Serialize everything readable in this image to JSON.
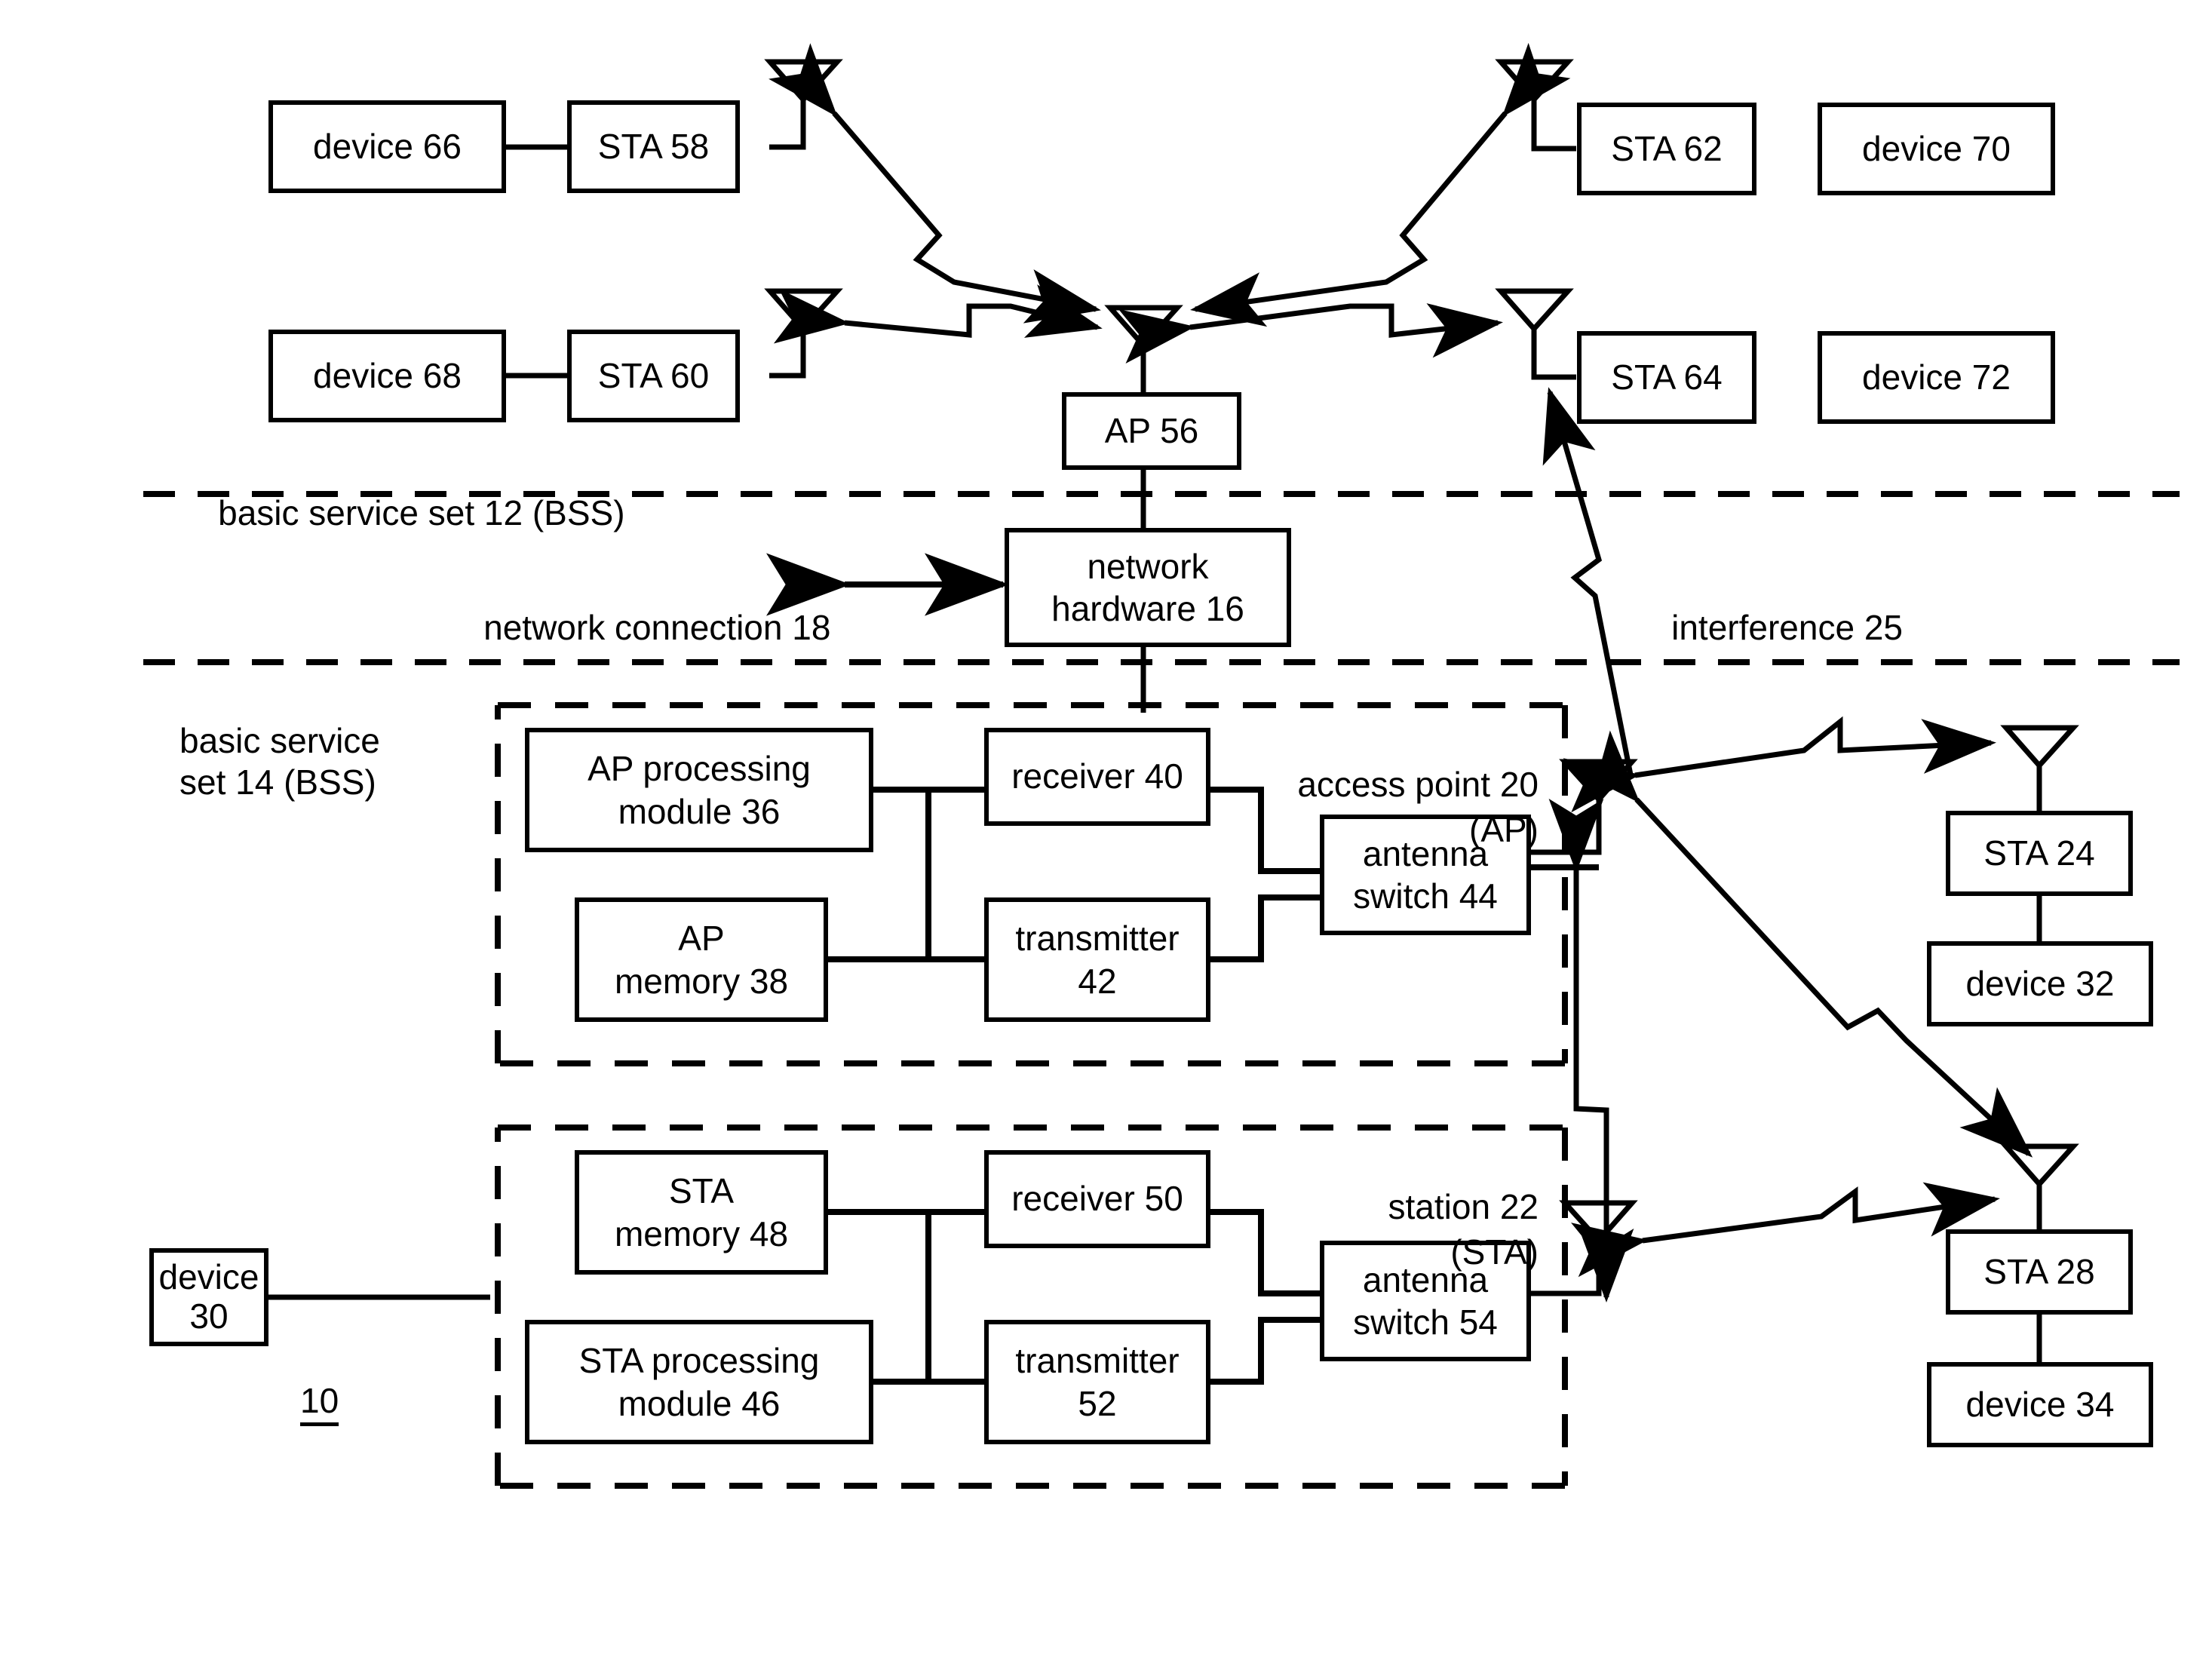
{
  "figure": {
    "reference_numeral": "10",
    "type": "wireless-network-block-diagram"
  },
  "regions": [
    {
      "id": "bss12",
      "label": "basic service set 12 (BSS)"
    },
    {
      "id": "bss14",
      "label": "basic service\nset 14 (BSS)"
    }
  ],
  "labels": {
    "network_connection": "network connection 18",
    "interference": "interference 25",
    "access_point_line1": "access point 20",
    "access_point_line2": "(AP)",
    "station_line1": "station 22",
    "station_line2": "(STA)"
  },
  "boxes": [
    {
      "id": "device66",
      "text": "device 66"
    },
    {
      "id": "sta58",
      "text": "STA 58"
    },
    {
      "id": "sta62",
      "text": "STA 62"
    },
    {
      "id": "device70",
      "text": "device 70"
    },
    {
      "id": "device68",
      "text": "device 68"
    },
    {
      "id": "sta60",
      "text": "STA 60"
    },
    {
      "id": "sta64",
      "text": "STA 64"
    },
    {
      "id": "device72",
      "text": "device 72"
    },
    {
      "id": "ap56",
      "text": "AP 56"
    },
    {
      "id": "nethw",
      "text": "network\nhardware 16"
    },
    {
      "id": "approc",
      "text": "AP processing\nmodule 36"
    },
    {
      "id": "apmem",
      "text": "AP\nmemory 38"
    },
    {
      "id": "rx40",
      "text": "receiver 40"
    },
    {
      "id": "tx42",
      "text": "transmitter\n42"
    },
    {
      "id": "asw44",
      "text": "antenna\nswitch 44"
    },
    {
      "id": "stamem48",
      "text": "STA\nmemory 48"
    },
    {
      "id": "staproc46",
      "text": "STA processing\nmodule 46"
    },
    {
      "id": "rx50",
      "text": "receiver 50"
    },
    {
      "id": "tx52",
      "text": "transmitter\n52"
    },
    {
      "id": "asw54",
      "text": "antenna\nswitch 54"
    },
    {
      "id": "device30",
      "text": "device 30"
    },
    {
      "id": "sta24",
      "text": "STA 24"
    },
    {
      "id": "device32",
      "text": "device 32"
    },
    {
      "id": "sta28",
      "text": "STA 28"
    },
    {
      "id": "device34",
      "text": "device 34"
    }
  ],
  "colors": {
    "stroke": "#000000",
    "background": "#ffffff"
  }
}
